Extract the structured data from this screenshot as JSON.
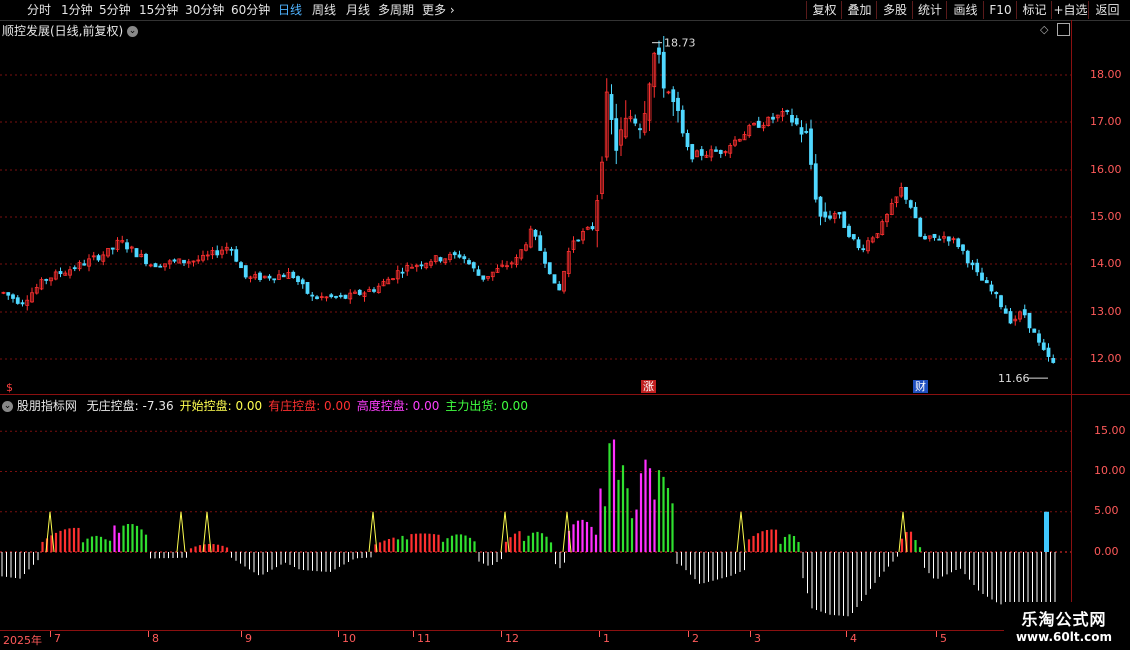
{
  "toolbar": {
    "periods": [
      "分时",
      "1分钟",
      "5分钟",
      "15分钟",
      "30分钟",
      "60分钟",
      "日线",
      "周线",
      "月线",
      "多周期",
      "更多"
    ],
    "active_period": "日线",
    "right_buttons": [
      "复权",
      "叠加",
      "多股",
      "统计",
      "画线",
      "F10",
      "标记",
      "+自选",
      "返回"
    ]
  },
  "main_panel": {
    "title": "顺控发展(日线,前复权)",
    "y_ticks": [
      "18.00",
      "17.00",
      "16.00",
      "15.00",
      "14.00",
      "13.00",
      "12.00"
    ],
    "high_label": "18.73",
    "low_label": "11.66",
    "markers": {
      "left": "$",
      "zhang": "涨",
      "cai": "财"
    }
  },
  "indicator_panel": {
    "name": "股朋指标网",
    "items": [
      {
        "label": "无庄控盘:",
        "value": "-7.36",
        "color": "#e8e8e8"
      },
      {
        "label": "开始控盘:",
        "value": "0.00",
        "color": "#ffff50"
      },
      {
        "label": "有庄控盘:",
        "value": "0.00",
        "color": "#ff3030"
      },
      {
        "label": "高度控盘:",
        "value": "0.00",
        "color": "#ff40ff"
      },
      {
        "label": "主力出货:",
        "value": "0.00",
        "color": "#40ff40"
      }
    ],
    "y_ticks": [
      "15.00",
      "10.00",
      "5.00",
      "0.00"
    ]
  },
  "date_axis": {
    "year": "2025年",
    "months": [
      "7",
      "8",
      "9",
      "10",
      "11",
      "12",
      "1",
      "2",
      "3",
      "4",
      "5"
    ]
  },
  "watermark": {
    "line1": "乐淘公式网",
    "line2": "www.60lt.com"
  },
  "colors": {
    "up": "#ff3030",
    "down": "#50d8ff",
    "grid": "#7a0f0f",
    "axis": "#ff5a5a",
    "white_bar": "#ffffff",
    "green_bar": "#30e030",
    "magenta_bar": "#ff30ff",
    "yellow_line": "#ffff50"
  }
}
